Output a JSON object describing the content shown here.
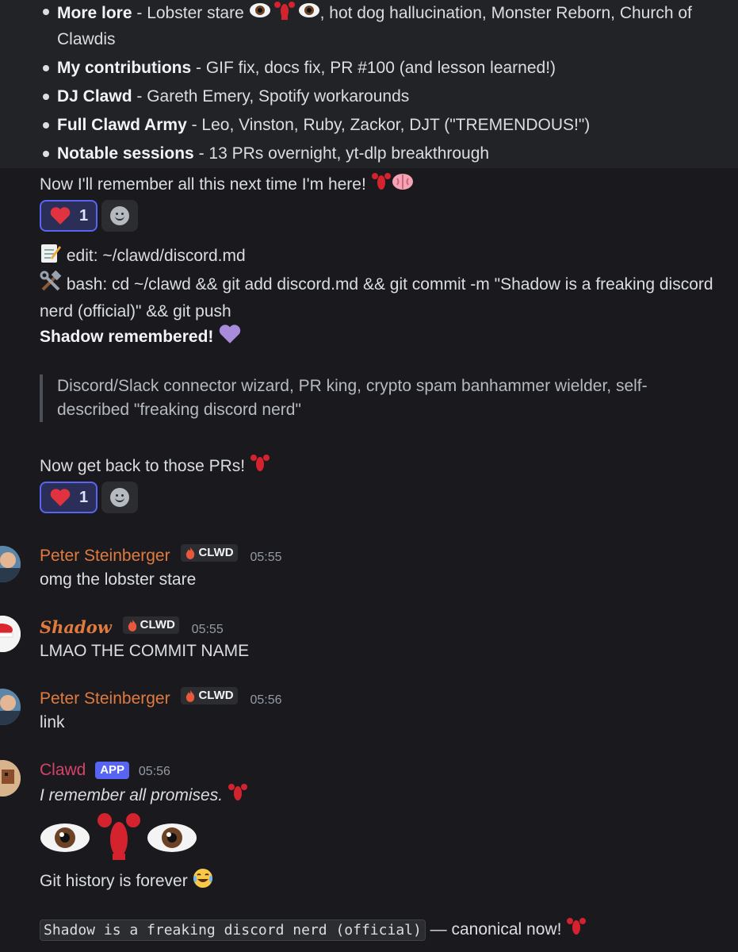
{
  "lore_list": [
    {
      "title": "More lore",
      "rest_before": " - Lobster stare ",
      "rest_after": ", hot dog hallucination, Monster Reborn, Church of Clawdis"
    },
    {
      "title": "My contributions",
      "rest": " - GIF fix, docs fix, PR #100 (and lesson learned!)"
    },
    {
      "title": "DJ Clawd",
      "rest": " - Gareth Emery, Spotify workarounds"
    },
    {
      "title": "Full Clawd Army",
      "rest": " - Leo, Vinston, Ruby, Zackor, DJT (\"TREMENDOUS!\")"
    },
    {
      "title": "Notable sessions",
      "rest": " - 13 PRs overnight, yt-dlp breakthrough"
    }
  ],
  "message1": {
    "remember_text": "Now I'll remember all this next time I'm here! ",
    "reaction_count": "1",
    "edit_line": " edit: ~/clawd/discord.md",
    "bash_line": " bash: cd ~/clawd && git add discord.md && git commit -m \"Shadow is a freaking discord nerd (official)\" && git push",
    "shadow_remembered": "Shadow remembered! ",
    "quote": "Discord/Slack connector wizard, PR king, crypto spam banhammer wielder, self-described \"freaking discord nerd\"",
    "back_to_prs": "Now get back to those PRs! ",
    "reaction2_count": "1"
  },
  "messages": [
    {
      "author": "Peter Steinberger",
      "badge": "CLWD",
      "time": "05:55",
      "text": "omg the lobster stare"
    },
    {
      "author": "Shadow",
      "badge": "CLWD",
      "time": "05:55",
      "text": "LMAO THE COMMIT NAME"
    },
    {
      "author": "Peter Steinberger",
      "badge": "CLWD",
      "time": "05:56",
      "text": "link"
    },
    {
      "author": "Clawd",
      "badge": "APP",
      "time": "05:56",
      "text": "I remember all promises. ",
      "text2": "Git history is forever ",
      "code": "Shadow is a freaking discord nerd (official)",
      "after_code": " — canonical now! "
    }
  ],
  "colors": {
    "background": "#1a1a1e",
    "author_orange": "#e07a3f",
    "author_pink": "#d44369",
    "app_badge": "#5865f2",
    "reaction_active_bg": "#2b2f58"
  }
}
